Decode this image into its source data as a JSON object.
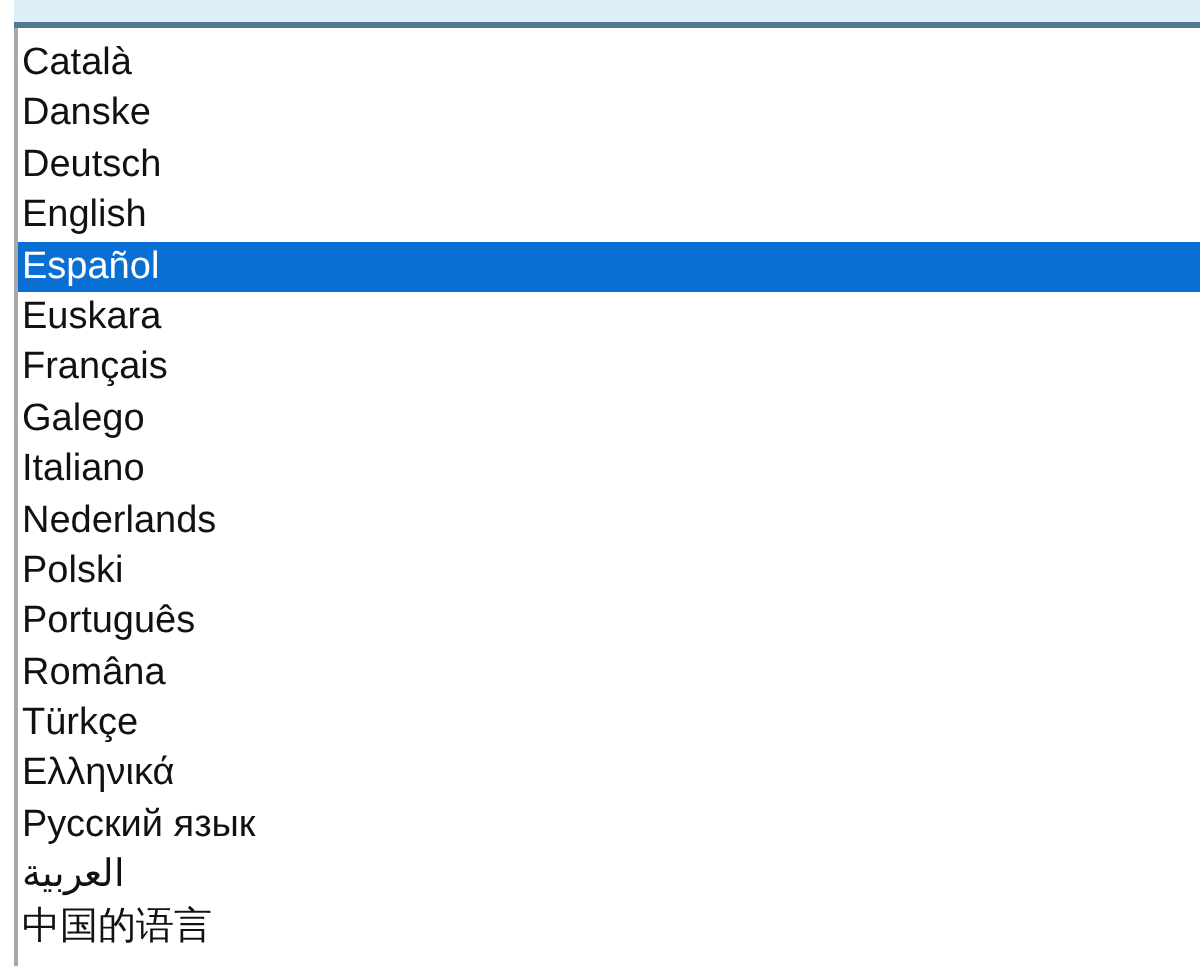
{
  "languages": [
    {
      "label": "Català",
      "selected": false
    },
    {
      "label": "Danske",
      "selected": false
    },
    {
      "label": "Deutsch",
      "selected": false
    },
    {
      "label": "English",
      "selected": false
    },
    {
      "label": "Español",
      "selected": true
    },
    {
      "label": "Euskara",
      "selected": false
    },
    {
      "label": "Français",
      "selected": false
    },
    {
      "label": "Galego",
      "selected": false
    },
    {
      "label": "Italiano",
      "selected": false
    },
    {
      "label": "Nederlands",
      "selected": false
    },
    {
      "label": "Polski",
      "selected": false
    },
    {
      "label": "Português",
      "selected": false
    },
    {
      "label": "Româna",
      "selected": false
    },
    {
      "label": "Türkçe",
      "selected": false
    },
    {
      "label": "Ελληνικά",
      "selected": false
    },
    {
      "label": "Русский язык",
      "selected": false
    },
    {
      "label": "العربية",
      "selected": false
    },
    {
      "label": "中国的语言",
      "selected": false
    }
  ]
}
